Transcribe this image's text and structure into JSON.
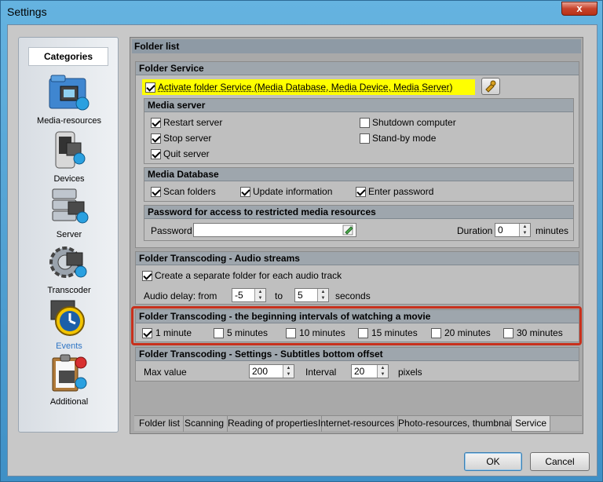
{
  "window": {
    "title": "Settings",
    "close_glyph": "x"
  },
  "sidebar": {
    "header": "Categories",
    "items": [
      {
        "label": "Media-resources",
        "icon": "media-folder-icon"
      },
      {
        "label": "Devices",
        "icon": "devices-icon"
      },
      {
        "label": "Server",
        "icon": "server-icon"
      },
      {
        "label": "Transcoder",
        "icon": "transcoder-gear-icon"
      },
      {
        "label": "Events",
        "icon": "events-clock-icon"
      },
      {
        "label": "Additional",
        "icon": "additional-clipboard-icon"
      }
    ],
    "active_color": "#2d74c4"
  },
  "main": {
    "header": "Folder list",
    "folder_service": {
      "title": "Folder Service",
      "activate_label": "Activate folder Service (Media Database, Media Device, Media Server)",
      "activate_checked": true,
      "highlight_color": "#ffff00"
    },
    "media_server": {
      "title": "Media server",
      "restart": "Restart server",
      "stop": "Stop server",
      "quit": "Quit server",
      "shutdown": "Shutdown computer",
      "standby": "Stand-by mode"
    },
    "media_database": {
      "title": "Media Database",
      "scan": "Scan folders",
      "update": "Update information",
      "enter_password": "Enter password"
    },
    "password_group": {
      "title": "Password for access to restricted media resources",
      "password_label": "Password",
      "password_value": "",
      "duration_label": "Duration",
      "duration_value": "0",
      "minutes_label": "minutes"
    },
    "audio_streams": {
      "title": "Folder Transcoding - Audio streams",
      "separate_folder": "Create a separate folder for each audio track",
      "delay_label": "Audio delay: from",
      "from_value": "-5",
      "to_label": "to",
      "to_value": "5",
      "seconds_label": "seconds"
    },
    "intervals": {
      "title": "Folder Transcoding - the beginning intervals of watching a movie",
      "options": [
        "1 minute",
        "5 minutes",
        "10 minutes",
        "15 minutes",
        "20 minutes",
        "30 minutes"
      ],
      "checked": [
        true,
        false,
        false,
        false,
        false,
        false
      ],
      "highlight_border": "#c8301c"
    },
    "subtitles": {
      "title": "Folder Transcoding - Settings - Subtitles bottom offset",
      "max_label": "Max value",
      "max_value": "200",
      "interval_label": "Interval",
      "interval_value": "20",
      "pixels_label": "pixels"
    }
  },
  "tabs": [
    "Folder list",
    "Scanning",
    "Reading of properties",
    "Internet-resources",
    "Photo-resources, thumbnails",
    "Service"
  ],
  "buttons": {
    "ok": "OK",
    "cancel": "Cancel"
  }
}
